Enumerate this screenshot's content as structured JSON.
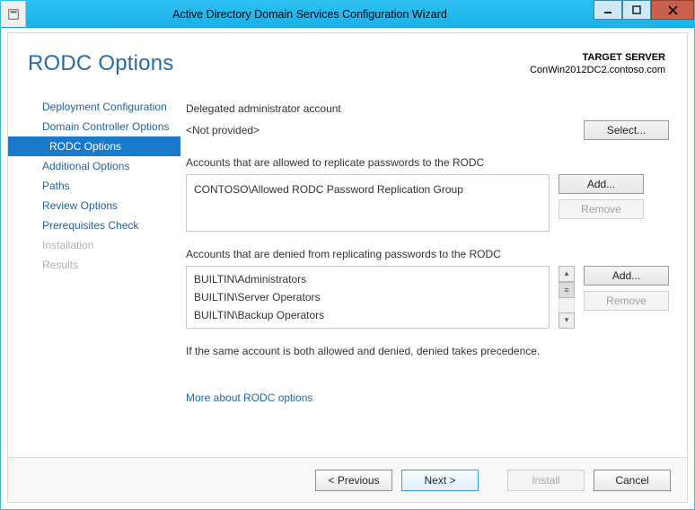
{
  "window": {
    "title": "Active Directory Domain Services Configuration Wizard"
  },
  "header": {
    "page_title": "RODC Options",
    "target_label": "TARGET SERVER",
    "target_value": "ConWin2012DC2.contoso.com"
  },
  "nav": {
    "items": [
      {
        "label": "Deployment Configuration",
        "state": "normal"
      },
      {
        "label": "Domain Controller Options",
        "state": "normal"
      },
      {
        "label": "RODC Options",
        "state": "active"
      },
      {
        "label": "Additional Options",
        "state": "normal"
      },
      {
        "label": "Paths",
        "state": "normal"
      },
      {
        "label": "Review Options",
        "state": "normal"
      },
      {
        "label": "Prerequisites Check",
        "state": "normal"
      },
      {
        "label": "Installation",
        "state": "disabled"
      },
      {
        "label": "Results",
        "state": "disabled"
      }
    ]
  },
  "main": {
    "delegated_label": "Delegated administrator account",
    "delegated_value": "<Not provided>",
    "select_btn": "Select...",
    "allowed_label": "Accounts that are allowed to replicate passwords to the RODC",
    "allowed_items": [
      "CONTOSO\\Allowed RODC Password Replication Group"
    ],
    "denied_label": "Accounts that are denied from replicating passwords to the RODC",
    "denied_items": [
      "BUILTIN\\Administrators",
      "BUILTIN\\Server Operators",
      "BUILTIN\\Backup Operators"
    ],
    "add_btn": "Add...",
    "remove_btn": "Remove",
    "note": "If the same account is both allowed and denied, denied takes precedence.",
    "more_link": "More about RODC options"
  },
  "footer": {
    "previous": "< Previous",
    "next": "Next >",
    "install": "Install",
    "cancel": "Cancel"
  }
}
